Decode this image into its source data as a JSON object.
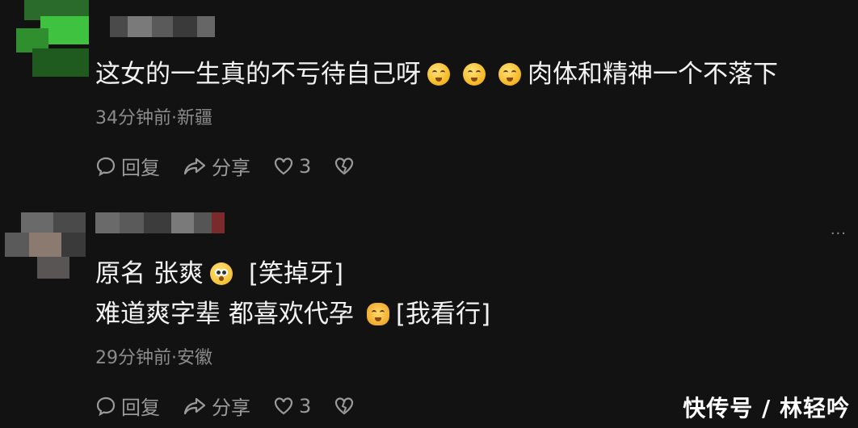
{
  "comments": [
    {
      "line1_pre": "这女的一生真的不亏待自己呀",
      "line1_post": "肉体和精神一个不落下",
      "meta": "34分钟前·新疆",
      "reply_label": "回复",
      "share_label": "分享",
      "like_count": "3"
    },
    {
      "line1_pre": "原名 张爽",
      "line1_post": "[笑掉牙]",
      "line2_pre": "难道爽字辈 都喜欢代孕",
      "line2_post": "[我看行]",
      "meta": "29分钟前·安徽",
      "reply_label": "回复",
      "share_label": "分享",
      "like_count": "3",
      "more": "···"
    }
  ],
  "watermark": "快传号 / 林轻吟",
  "colors": {
    "background": "#121212",
    "text": "#f2f2f2",
    "meta": "#8c8c8c",
    "avatar1": "#3fbf3f"
  }
}
